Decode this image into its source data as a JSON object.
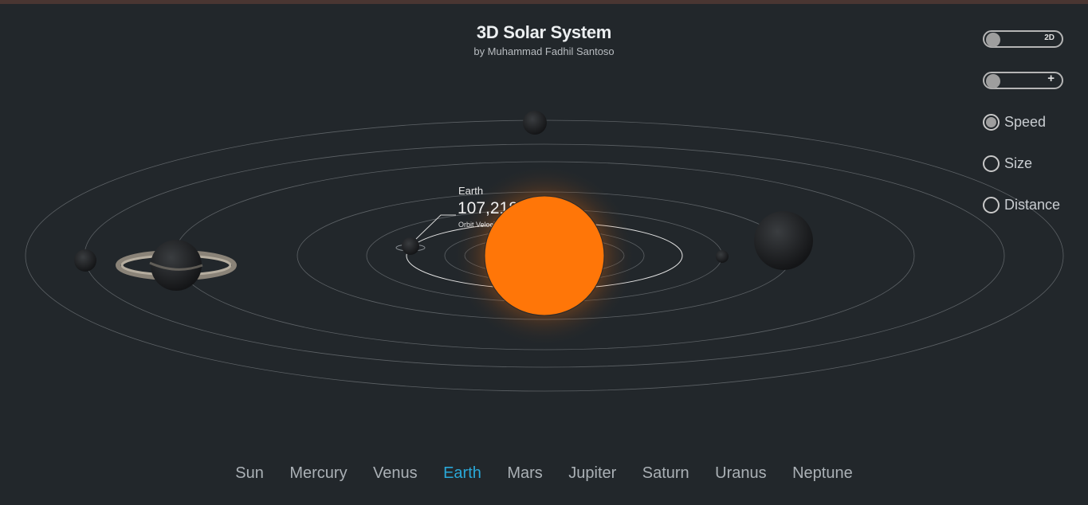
{
  "header": {
    "title": "3D Solar System",
    "subtitle": "by Muhammad Fadhil Santoso"
  },
  "controls": {
    "view_toggle_label": "2D",
    "zoom_toggle_label": "+",
    "scale_options": [
      {
        "label": "Speed",
        "selected": true
      },
      {
        "label": "Size",
        "selected": false
      },
      {
        "label": "Distance",
        "selected": false
      }
    ]
  },
  "planet_label": {
    "name": "Earth",
    "value": "107,218",
    "caption": "Orbit Velocity (km/h)"
  },
  "nav": {
    "items": [
      "Sun",
      "Mercury",
      "Venus",
      "Earth",
      "Mars",
      "Jupiter",
      "Saturn",
      "Uranus",
      "Neptune"
    ],
    "active": "Earth"
  },
  "colors": {
    "background": "#22272b",
    "sun": "#ff7608",
    "active_nav": "#2aa8d8"
  }
}
